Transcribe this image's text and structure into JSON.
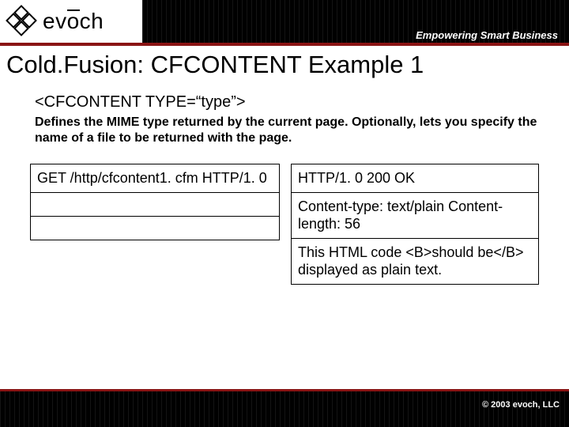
{
  "header": {
    "brand": "evōch",
    "tagline": "Empowering Smart Business"
  },
  "title": "Cold.Fusion: CFCONTENT Example 1",
  "syntax": "<CFCONTENT TYPE=“type”>",
  "description": "Defines the MIME type returned by the current page. Optionally, lets you specify the name of a file to be returned with the page.",
  "request_table": {
    "rows": [
      "GET /http/cfcontent1. cfm HTTP/1. 0",
      "",
      ""
    ]
  },
  "response_table": {
    "rows": [
      "HTTP/1. 0 200 OK",
      "Content-type: text/plain\nContent-length: 56",
      "This HTML code <B>should be</B> displayed as plain text."
    ]
  },
  "footer": {
    "copyright": "© 2003 evoch, LLC"
  }
}
